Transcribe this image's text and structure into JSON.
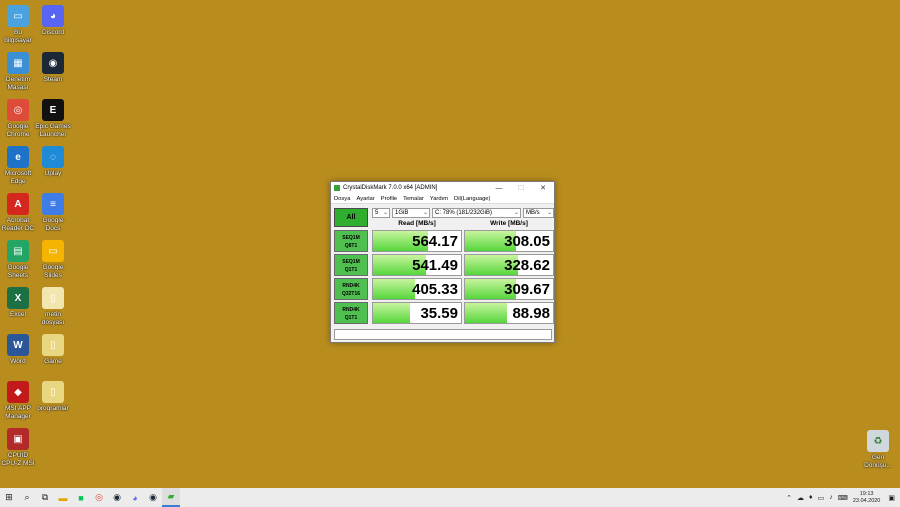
{
  "desktop": {
    "icons": [
      {
        "label": "Bu\nbilgisayar",
        "color": "#4aa3df",
        "glyph": "▭"
      },
      {
        "label": "Discord",
        "color": "#5865f2",
        "glyph": "◕"
      },
      {
        "label": "Denetim\nMasası",
        "color": "#3b8fd4",
        "glyph": "▦"
      },
      {
        "label": "Steam",
        "color": "#1b2838",
        "glyph": "◉"
      },
      {
        "label": "Google\nChrome",
        "color": "#dd4b39",
        "glyph": "◎"
      },
      {
        "label": "Epic Games\nLauncher",
        "color": "#111111",
        "glyph": "E"
      },
      {
        "label": "Microsoft\nEdge",
        "color": "#1e73c8",
        "glyph": "e"
      },
      {
        "label": "Uplay",
        "color": "#1f8ad6",
        "glyph": "◌"
      },
      {
        "label": "Acrobat\nReader DC",
        "color": "#d4271e",
        "glyph": "A"
      },
      {
        "label": "Google\nDocs",
        "color": "#3f7de6",
        "glyph": "≡"
      },
      {
        "label": "Google\nSheets",
        "color": "#23a566",
        "glyph": "▤"
      },
      {
        "label": "Google\nSlides",
        "color": "#f4b400",
        "glyph": "▭"
      },
      {
        "label": "Excel",
        "color": "#1d7044",
        "glyph": "X"
      },
      {
        "label": "metin\ndosyası",
        "color": "#f2e6b0",
        "glyph": "▯"
      },
      {
        "label": "Word",
        "color": "#2b579a",
        "glyph": "W"
      },
      {
        "label": "Game",
        "color": "#e9d680",
        "glyph": "▯"
      },
      {
        "label": "MSI APP\nManager",
        "color": "#c21a1a",
        "glyph": "◆"
      },
      {
        "label": "programlar",
        "color": "#e9d680",
        "glyph": "▯"
      },
      {
        "label": "CPUID\nCPU-Z MSI",
        "color": "#b22a2a",
        "glyph": "▣"
      }
    ],
    "recycle_bin": {
      "label": "Geri\nDönüşü...",
      "glyph": "♻"
    }
  },
  "window": {
    "title": "CrystalDiskMark 7.0.0 x64 [ADMIN]",
    "menu": [
      "Dosya",
      "Ayarlar",
      "Profile",
      "Temalar",
      "Yardım",
      "Dil(Language)"
    ],
    "all_button": "All",
    "count": "5",
    "size": "1GiB",
    "drive": "C: 78% (181/232GiB)",
    "unit": "MB/s",
    "read_header": "Read [MB/s]",
    "write_header": "Write [MB/s]",
    "tests": [
      {
        "line1": "SEQ1M",
        "line2": "Q8T1",
        "read": "564.17",
        "write": "308.05",
        "read_fill": 0.62,
        "write_fill": 0.58
      },
      {
        "line1": "SEQ1M",
        "line2": "Q1T1",
        "read": "541.49",
        "write": "328.62",
        "read_fill": 0.6,
        "write_fill": 0.6
      },
      {
        "line1": "RND4K",
        "line2": "Q32T16",
        "read": "405.33",
        "write": "309.67",
        "read_fill": 0.48,
        "write_fill": 0.58
      },
      {
        "line1": "RND4K",
        "line2": "Q1T1",
        "read": "35.59",
        "write": "88.98",
        "read_fill": 0.42,
        "write_fill": 0.48
      }
    ]
  },
  "taskbar": {
    "items": [
      "start",
      "search",
      "task-view",
      "explorer",
      "line",
      "chrome",
      "steam",
      "discord",
      "steam2",
      "crystaldiskmark"
    ],
    "time": "19:13",
    "date": "23.04.2020"
  }
}
